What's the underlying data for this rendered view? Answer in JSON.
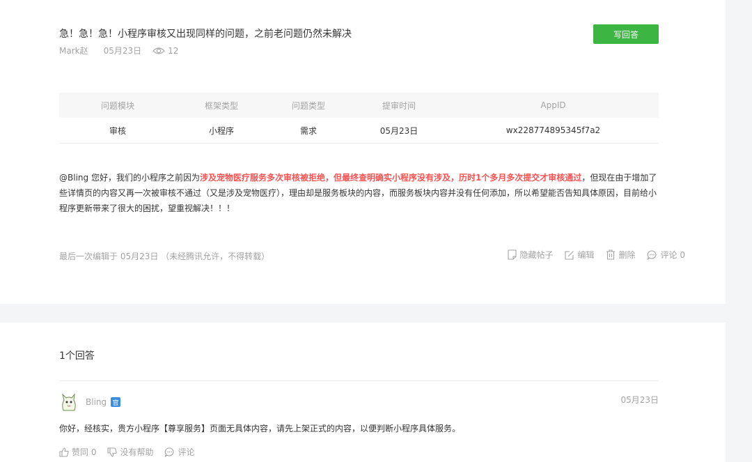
{
  "question": {
    "title": "急！急！急！小程序审核又出现同样的问题，之前老问题仍然未解决",
    "author": "Mark赵",
    "date": "05月23日",
    "views": "12",
    "write_answer_label": "写回答",
    "table": {
      "headers": [
        "问题模块",
        "框架类型",
        "问题类型",
        "提审时间",
        "AppID"
      ],
      "row": [
        "审核",
        "小程序",
        "需求",
        "05月23日",
        "wx228774895345f7a2"
      ]
    },
    "body": {
      "part1": "@Bling 您好，我们的小程序之前因为",
      "highlight": "涉及宠物医疗服务多次审核被拒绝，但最终查明确实小程序没有涉及，历时1个多月多次提交才审核通过",
      "part2": "，但现在由于增加了些详情页的内容又再一次被审核不通过（又是涉及宠物医疗），理由却是服务板块的内容，而服务板块内容并没有任何添加，所以希望能否告知具体原因，目前给小程序更新带来了很大的困扰，望重视解决！！！"
    },
    "footer_note": "最后一次编辑于  05月23日  （未经腾讯允许，不得转载）",
    "actions": {
      "hide": "隐藏帖子",
      "edit": "编辑",
      "delete": "删除",
      "comment": "评论 0"
    }
  },
  "answers": {
    "count_label": "1个回答",
    "items": [
      {
        "user": "Bling",
        "badge": "官",
        "date": "05月23日",
        "text": "你好，经核实，贵方小程序【尊享服务】页面无具体内容，请先上架正式的内容，以便判断小程序具体服务。",
        "like": "赞同 0",
        "unhelpful": "没有帮助",
        "comment": "评论"
      }
    ]
  },
  "colors": {
    "accent_green": "#3cb542",
    "highlight_red": "#fa5151",
    "badge_blue": "#3b8de0"
  }
}
